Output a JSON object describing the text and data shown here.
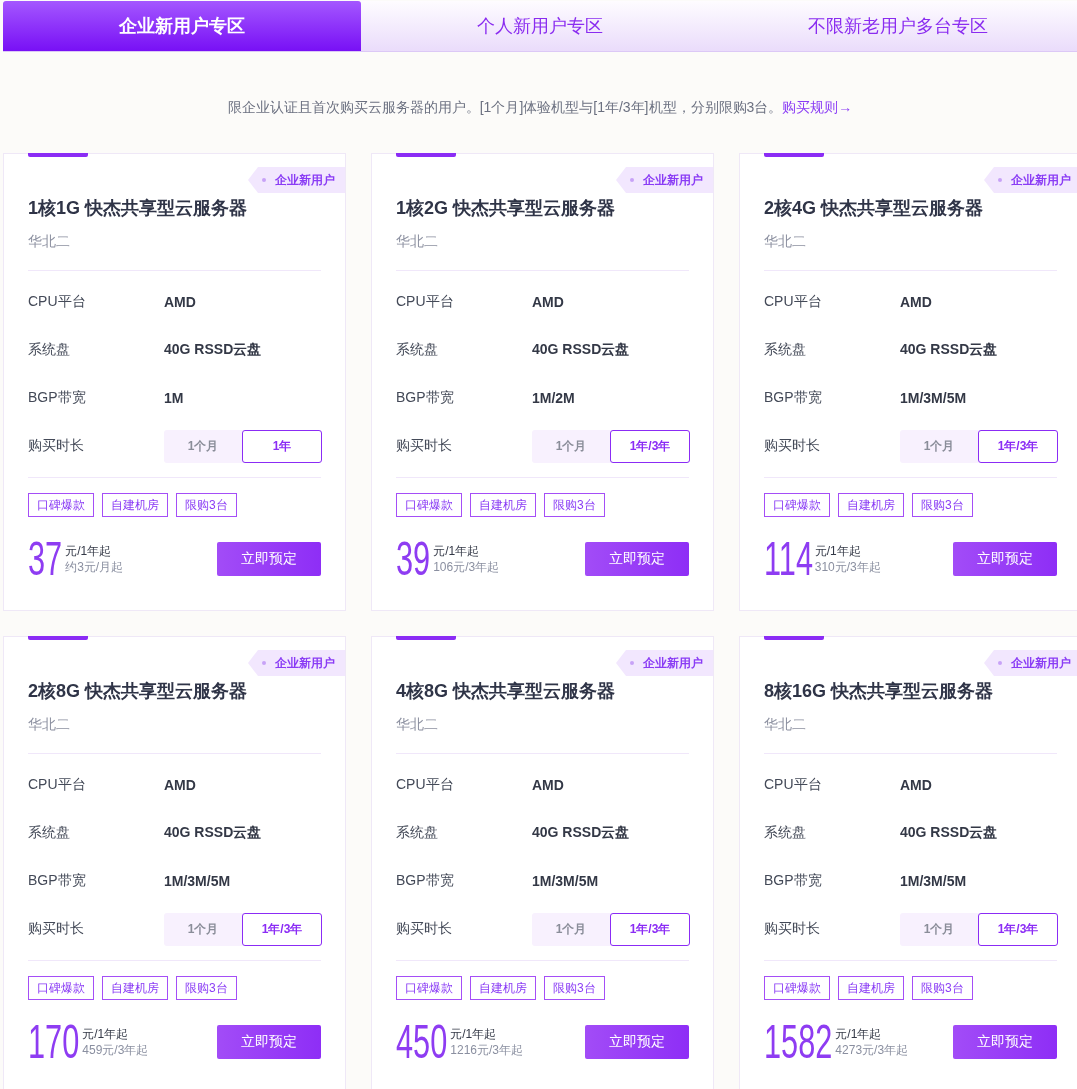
{
  "tabs": [
    {
      "label": "企业新用户专区",
      "selected": true
    },
    {
      "label": "个人新用户专区",
      "selected": false
    },
    {
      "label": "不限新老用户多台专区",
      "selected": false
    }
  ],
  "notice": {
    "text": "限企业认证且首次购买云服务器的用户。[1个月]体验机型与[1年/3年]机型，分别限购3台。",
    "link": "购买规则→"
  },
  "products": [
    {
      "ribbon": "企业新用户",
      "title": "1核1G 快杰共享型云服务器",
      "region": "华北二",
      "specs": [
        {
          "label": "CPU平台",
          "value": "AMD"
        },
        {
          "label": "系统盘",
          "value": "40G RSSD云盘"
        },
        {
          "label": "BGP带宽",
          "value": "1M"
        }
      ],
      "duration_label": "购买时长",
      "durations": [
        {
          "label": "1个月",
          "selected": false
        },
        {
          "label": "1年",
          "selected": true
        }
      ],
      "tags": [
        "口碑爆款",
        "自建机房",
        "限购3台"
      ],
      "price": "37",
      "price_unit": "元/1年起",
      "price_note": "约3元/月起",
      "button": "立即预定"
    },
    {
      "ribbon": "企业新用户",
      "title": "1核2G 快杰共享型云服务器",
      "region": "华北二",
      "specs": [
        {
          "label": "CPU平台",
          "value": "AMD"
        },
        {
          "label": "系统盘",
          "value": "40G RSSD云盘"
        },
        {
          "label": "BGP带宽",
          "value": "1M/2M"
        }
      ],
      "duration_label": "购买时长",
      "durations": [
        {
          "label": "1个月",
          "selected": false
        },
        {
          "label": "1年/3年",
          "selected": true
        }
      ],
      "tags": [
        "口碑爆款",
        "自建机房",
        "限购3台"
      ],
      "price": "39",
      "price_unit": "元/1年起",
      "price_note": "106元/3年起",
      "button": "立即预定"
    },
    {
      "ribbon": "企业新用户",
      "title": "2核4G 快杰共享型云服务器",
      "region": "华北二",
      "specs": [
        {
          "label": "CPU平台",
          "value": "AMD"
        },
        {
          "label": "系统盘",
          "value": "40G RSSD云盘"
        },
        {
          "label": "BGP带宽",
          "value": "1M/3M/5M"
        }
      ],
      "duration_label": "购买时长",
      "durations": [
        {
          "label": "1个月",
          "selected": false
        },
        {
          "label": "1年/3年",
          "selected": true
        }
      ],
      "tags": [
        "口碑爆款",
        "自建机房",
        "限购3台"
      ],
      "price": "114",
      "price_unit": "元/1年起",
      "price_note": "310元/3年起",
      "button": "立即预定"
    },
    {
      "ribbon": "企业新用户",
      "title": "2核8G 快杰共享型云服务器",
      "region": "华北二",
      "specs": [
        {
          "label": "CPU平台",
          "value": "AMD"
        },
        {
          "label": "系统盘",
          "value": "40G RSSD云盘"
        },
        {
          "label": "BGP带宽",
          "value": "1M/3M/5M"
        }
      ],
      "duration_label": "购买时长",
      "durations": [
        {
          "label": "1个月",
          "selected": false
        },
        {
          "label": "1年/3年",
          "selected": true
        }
      ],
      "tags": [
        "口碑爆款",
        "自建机房",
        "限购3台"
      ],
      "price": "170",
      "price_unit": "元/1年起",
      "price_note": "459元/3年起",
      "button": "立即预定"
    },
    {
      "ribbon": "企业新用户",
      "title": "4核8G 快杰共享型云服务器",
      "region": "华北二",
      "specs": [
        {
          "label": "CPU平台",
          "value": "AMD"
        },
        {
          "label": "系统盘",
          "value": "40G RSSD云盘"
        },
        {
          "label": "BGP带宽",
          "value": "1M/3M/5M"
        }
      ],
      "duration_label": "购买时长",
      "durations": [
        {
          "label": "1个月",
          "selected": false
        },
        {
          "label": "1年/3年",
          "selected": true
        }
      ],
      "tags": [
        "口碑爆款",
        "自建机房",
        "限购3台"
      ],
      "price": "450",
      "price_unit": "元/1年起",
      "price_note": "1216元/3年起",
      "button": "立即预定"
    },
    {
      "ribbon": "企业新用户",
      "title": "8核16G 快杰共享型云服务器",
      "region": "华北二",
      "specs": [
        {
          "label": "CPU平台",
          "value": "AMD"
        },
        {
          "label": "系统盘",
          "value": "40G RSSD云盘"
        },
        {
          "label": "BGP带宽",
          "value": "1M/3M/5M"
        }
      ],
      "duration_label": "购买时长",
      "durations": [
        {
          "label": "1个月",
          "selected": false
        },
        {
          "label": "1年/3年",
          "selected": true
        }
      ],
      "tags": [
        "口碑爆款",
        "自建机房",
        "限购3台"
      ],
      "price": "1582",
      "price_unit": "元/1年起",
      "price_note": "4273元/3年起",
      "button": "立即预定"
    }
  ]
}
